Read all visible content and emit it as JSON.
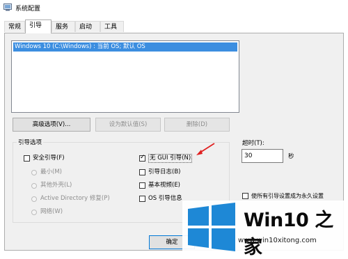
{
  "window": {
    "title": "系统配置"
  },
  "tabs": [
    {
      "label": "常规"
    },
    {
      "label": "引导"
    },
    {
      "label": "服务"
    },
    {
      "label": "启动"
    },
    {
      "label": "工具"
    }
  ],
  "boot_list": {
    "entries": [
      "Windows 10 (C:\\Windows) : 当前 OS; 默认 OS"
    ]
  },
  "buttons": {
    "advanced": "高级选项(V)...",
    "set_default": "设为默认值(S)",
    "delete": "删除(D)",
    "ok": "确定"
  },
  "boot_options": {
    "title": "引导选项",
    "safe_boot": "安全引导(F)",
    "minimal": "最小(M)",
    "alternate_shell": "其他外壳(L)",
    "active_directory": "Active Directory 修复(P)",
    "network": "网络(W)",
    "no_gui": "无 GUI 引导(N)",
    "no_gui_checked": true,
    "boot_log": "引导日志(B)",
    "base_video": "基本视频(E)",
    "os_boot_info": "OS 引导信息"
  },
  "timeout": {
    "label": "超时(T):",
    "value": "30",
    "unit": "秒"
  },
  "make_permanent": "使所有引导设置成为永久设置",
  "watermark": {
    "title": "Win10 之家",
    "url": "www.win10xitong.com"
  },
  "colors": {
    "selection": "#3c8ee0",
    "logo_blue": "#1e88d6",
    "arrow_red": "#e02020"
  }
}
